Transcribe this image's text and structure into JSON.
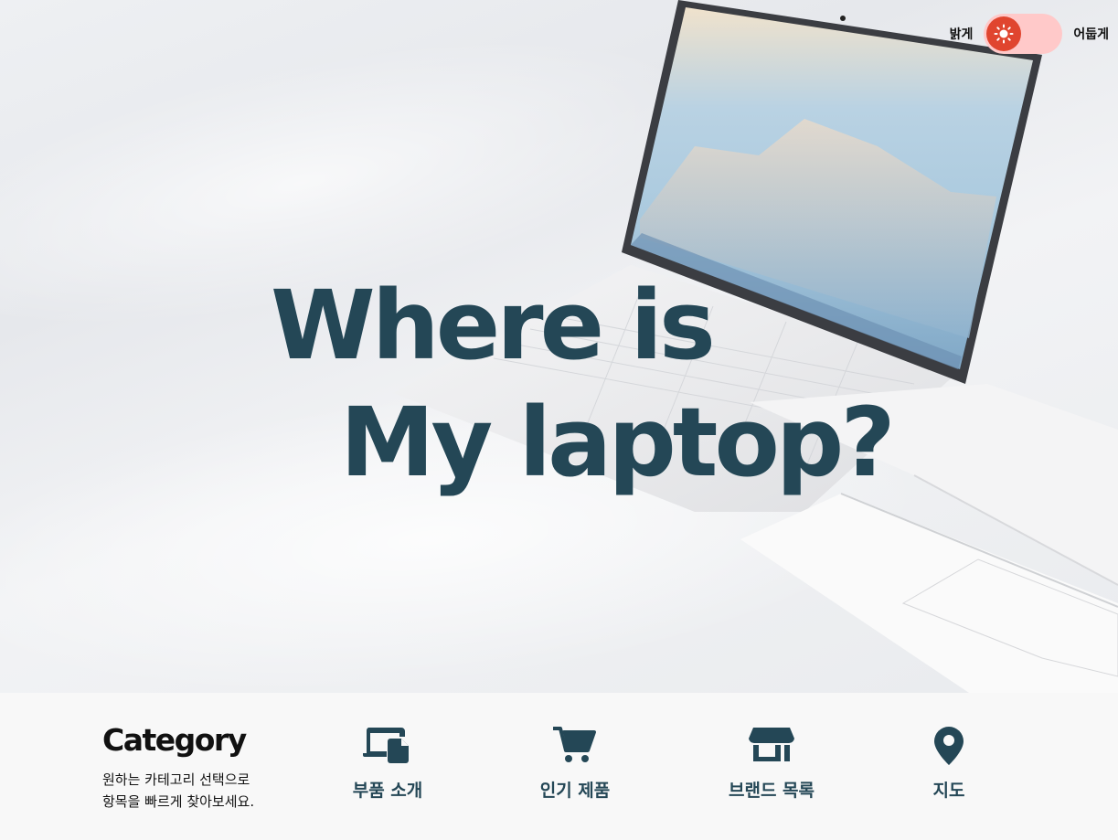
{
  "hero": {
    "title_line1": "Where is",
    "title_line2": "My laptop?"
  },
  "theme_toggle": {
    "light_label": "밝게",
    "dark_label": "어둡게",
    "state": "light",
    "knob_color": "#e0452f",
    "track_color": "#ffc9c9"
  },
  "category": {
    "heading": "Category",
    "description_line1": "원하는 카테고리 선택으로",
    "description_line2": "항목을 빠르게 찾아보세요.",
    "items": [
      {
        "label": "부품 소개",
        "icon": "devices-icon"
      },
      {
        "label": "인기 제품",
        "icon": "cart-icon"
      },
      {
        "label": "브랜드 목록",
        "icon": "store-icon"
      },
      {
        "label": "지도",
        "icon": "map-pin-icon"
      }
    ]
  },
  "colors": {
    "accent": "#244756",
    "toggle_knob": "#e0452f"
  }
}
